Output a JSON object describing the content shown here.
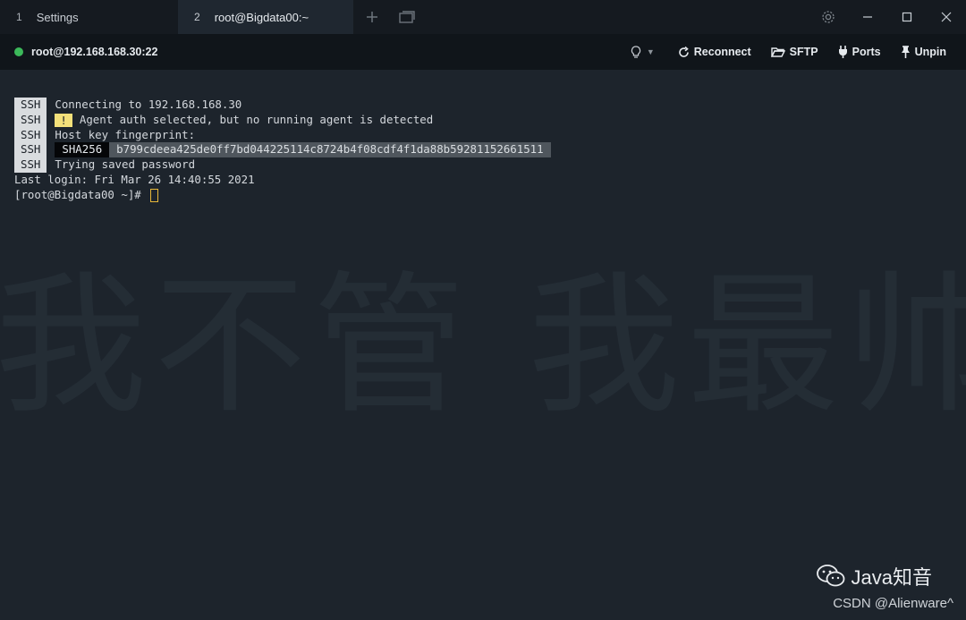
{
  "tabs": [
    {
      "number": "1",
      "label": "Settings"
    },
    {
      "number": "2",
      "label": "root@Bigdata00:~"
    }
  ],
  "toolbar": {
    "host": "root@192.168.168.30:22",
    "status_color": "#3cb95a",
    "reconnect_label": "Reconnect",
    "sftp_label": "SFTP",
    "ports_label": "Ports",
    "unpin_label": "Unpin"
  },
  "terminal": {
    "badge": "SSH",
    "line1": "Connecting to 192.168.168.30",
    "warn_mark": "!",
    "line2": "Agent auth selected, but no running agent is detected",
    "line3": "Host key fingerprint:",
    "sha_label": "SHA256",
    "sha_value": "b799cdeea425de0ff7bd044225114c8724b4f08cdf4f1da88b59281152661511",
    "line5": "Trying saved password",
    "last_login": "Last login: Fri Mar 26 14:40:55 2021",
    "prompt": "[root@Bigdata00 ~]# ",
    "background_text": "我不管 我最帅"
  },
  "watermark": {
    "brand": "Java知音",
    "credit": "CSDN @Alienware^"
  }
}
